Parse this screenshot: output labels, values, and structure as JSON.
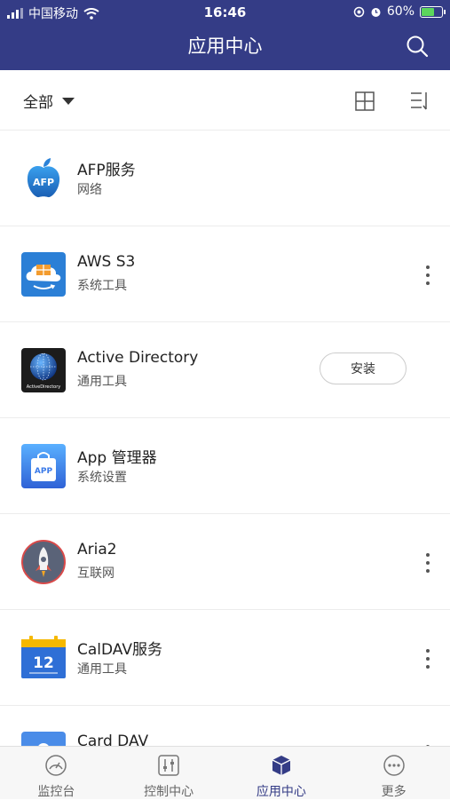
{
  "status": {
    "carrier": "中国移动",
    "time": "16:46",
    "battery": "60%"
  },
  "header": {
    "title": "应用中心"
  },
  "filter": {
    "label": "全部"
  },
  "apps": [
    {
      "name": "AFP服务",
      "category": "网络",
      "action": "none",
      "icon": "apple-icon",
      "icon_text": "AFP"
    },
    {
      "name": "AWS S3",
      "category": "系统工具",
      "action": "more",
      "icon": "aws-s3-icon"
    },
    {
      "name": "Active Directory",
      "category": "通用工具",
      "action": "install",
      "action_label": "安装",
      "icon": "active-directory-icon",
      "icon_text": "ActiveDirectory"
    },
    {
      "name": "App 管理器",
      "category": "系统设置",
      "action": "none",
      "icon": "app-manager-icon",
      "icon_text": "APP"
    },
    {
      "name": "Aria2",
      "category": "互联网",
      "action": "more",
      "icon": "rocket-icon"
    },
    {
      "name": "CalDAV服务",
      "category": "通用工具",
      "action": "more",
      "icon": "calendar-icon",
      "icon_text": "12"
    },
    {
      "name": "Card DAV",
      "category": "",
      "action": "more",
      "icon": "carddav-icon"
    }
  ],
  "tabs": [
    {
      "label": "监控台",
      "icon": "gauge-icon",
      "active": false
    },
    {
      "label": "控制中心",
      "icon": "sliders-icon",
      "active": false
    },
    {
      "label": "应用中心",
      "icon": "cube-icon",
      "active": true
    },
    {
      "label": "更多",
      "icon": "more-circle-icon",
      "active": false
    }
  ],
  "colors": {
    "primary": "#343c86",
    "divider": "#ececec"
  }
}
